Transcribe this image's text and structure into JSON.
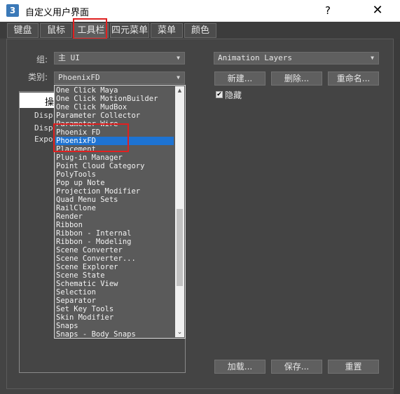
{
  "window": {
    "app_icon": "3",
    "title": "自定义用户界面",
    "help": "?",
    "close": "✕"
  },
  "tabs": [
    {
      "label": "键盘"
    },
    {
      "label": "鼠标"
    },
    {
      "label": "工具栏"
    },
    {
      "label": "四元菜单"
    },
    {
      "label": "菜单"
    },
    {
      "label": "颜色"
    }
  ],
  "group": {
    "label": "组:",
    "value": "主 UI"
  },
  "category": {
    "label": "类别:",
    "value": "PhoenixFD"
  },
  "action_list": {
    "header": "操",
    "rows": [
      "Disp",
      "Disp",
      "Expo"
    ]
  },
  "dropdown_items": [
    "One Click Maya",
    "One Click MotionBuilder",
    "One Click MudBox",
    "Parameter Collector",
    "Parameter Wire",
    "Phoenix FD",
    "PhoenixFD",
    "Placement",
    "Plug-in Manager",
    "Point Cloud Category",
    "PolyTools",
    "Pop up Note",
    "Projection Modifier",
    "Quad Menu Sets",
    "RailClone",
    "Render",
    "Ribbon",
    "Ribbon - Internal",
    "Ribbon - Modeling",
    "Scene Converter",
    "Scene Converter...",
    "Scene Explorer",
    "Scene State",
    "Schematic View",
    "Selection",
    "Separator",
    "Set Key Tools",
    "Skin Modifier",
    "Snaps",
    "Snaps - Body Snaps"
  ],
  "dropdown_selected_index": 6,
  "toolbar_combo": {
    "value": "Animation Layers"
  },
  "toolbar_buttons": {
    "new": "新建...",
    "delete": "删除...",
    "rename": "重命名..."
  },
  "hide_checkbox": {
    "label": "隐藏",
    "checked": true,
    "mark": "✔"
  },
  "bottom_buttons": {
    "load": "加载...",
    "save": "保存...",
    "reset": "重置"
  },
  "colors": {
    "selected": "#1e73d2",
    "highlight": "#e02020"
  }
}
